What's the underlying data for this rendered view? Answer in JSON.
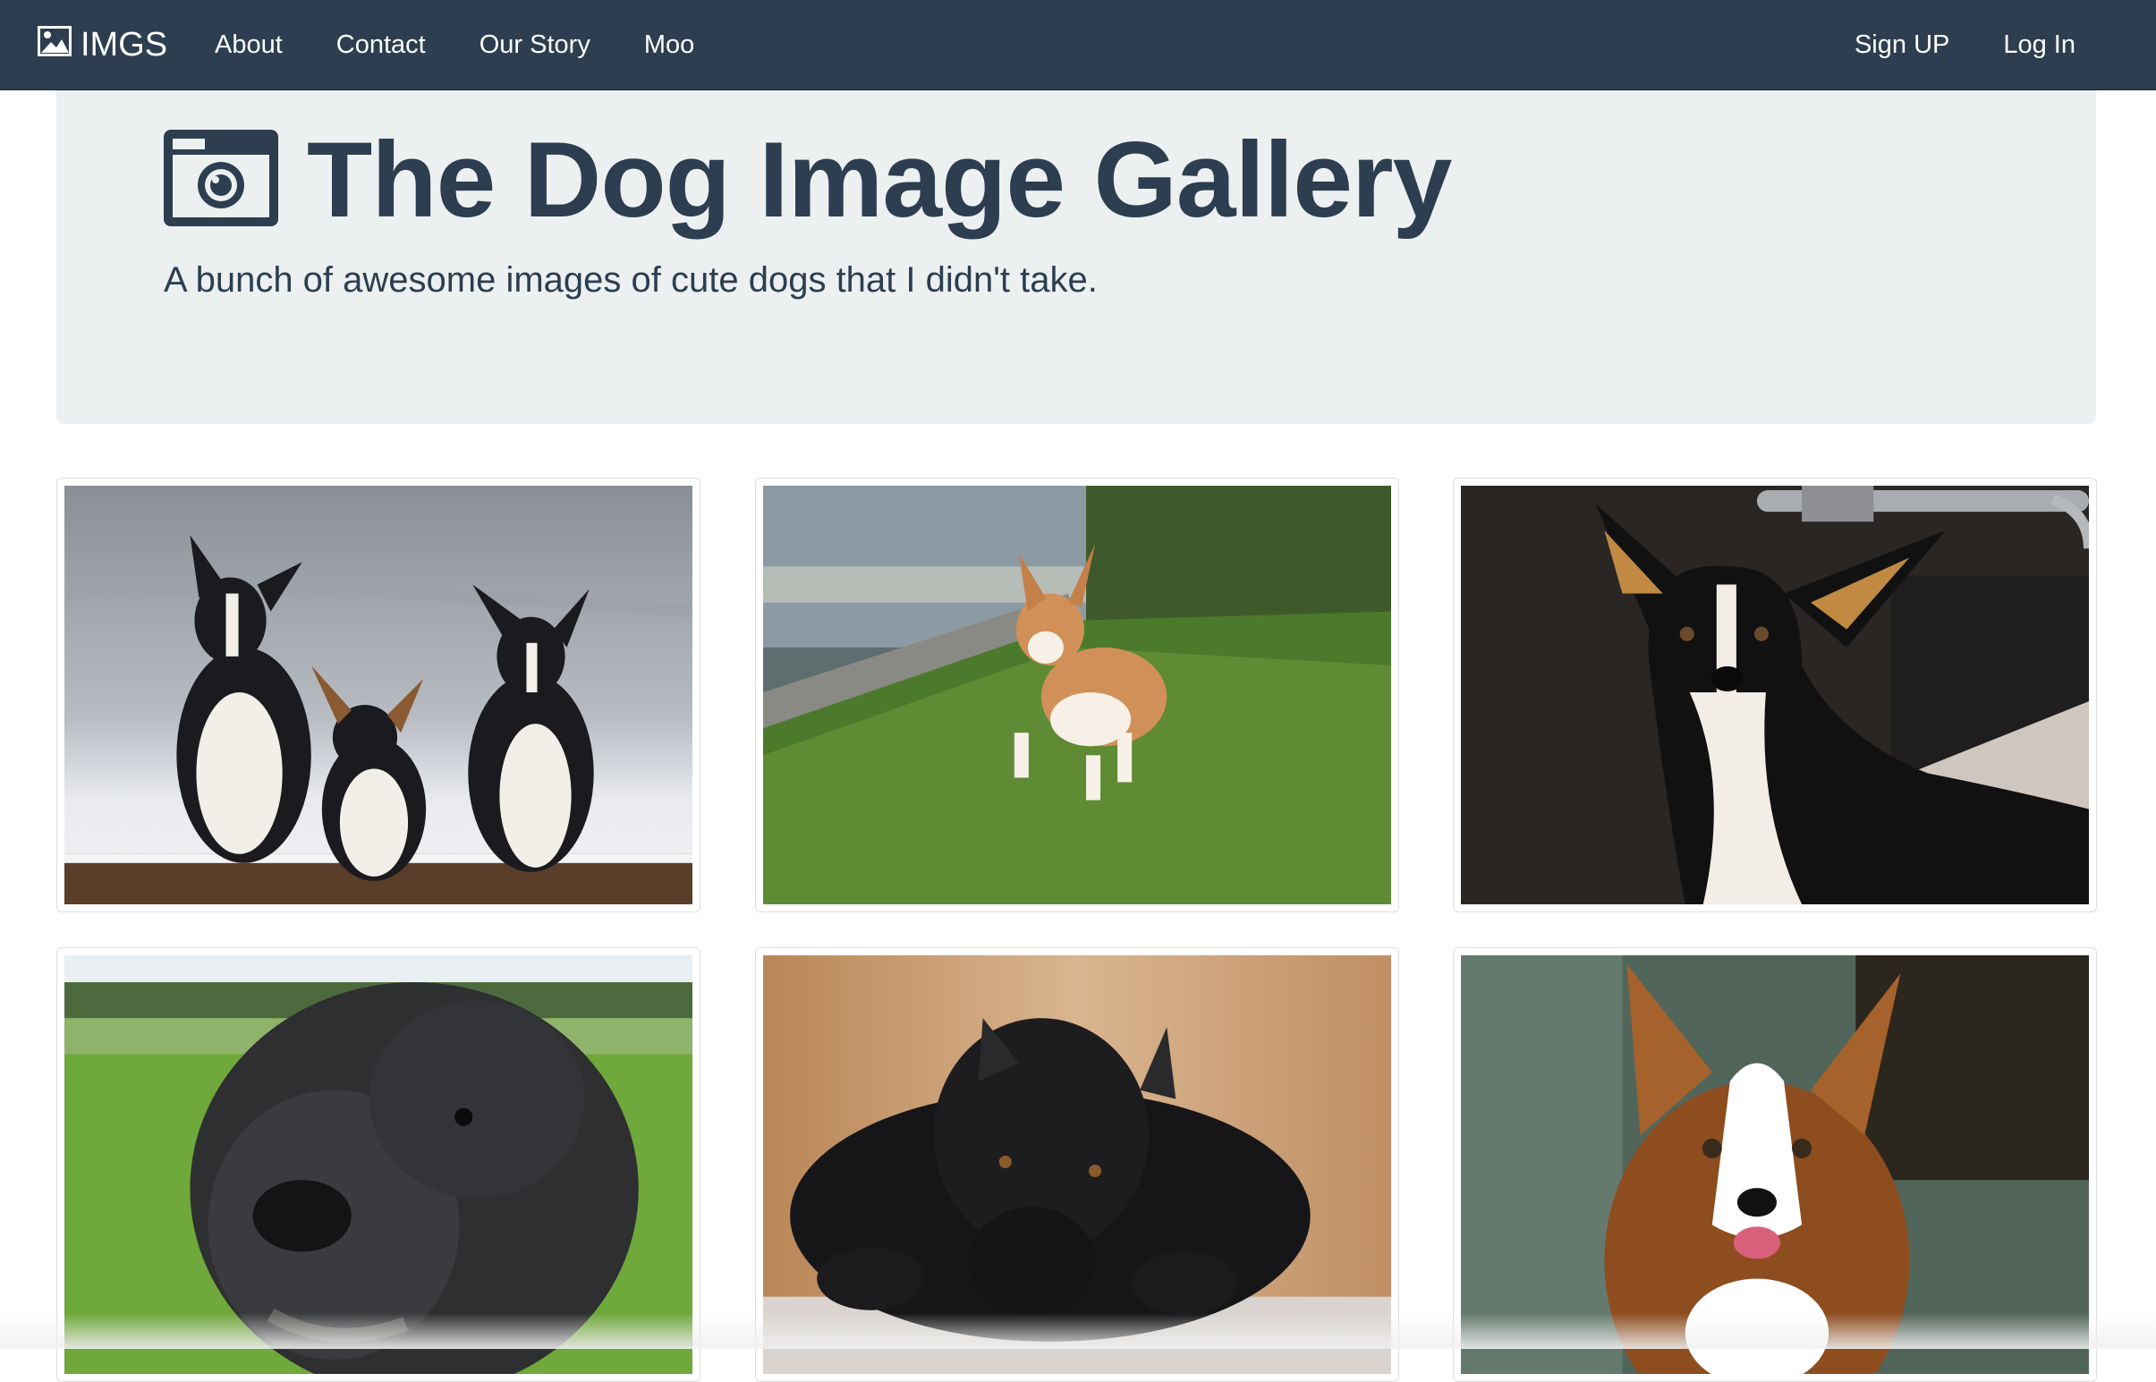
{
  "navbar": {
    "brand": "IMGS",
    "brand_icon": "image-icon",
    "links_left": [
      "About",
      "Contact",
      "Our Story",
      "Moo"
    ],
    "links_right": [
      "Sign UP",
      "Log In"
    ],
    "bg_color": "#2c3e50"
  },
  "jumbotron": {
    "icon": "camera-icon",
    "title": "The Dog Image Gallery",
    "subtitle": "A bunch of awesome images of cute dogs that I didn't take."
  },
  "gallery": {
    "images": [
      {
        "subject": "three corgis on snowy log"
      },
      {
        "subject": "corgi puppy running on grass"
      },
      {
        "subject": "tricolor corgi close-up"
      },
      {
        "subject": "black curly puppy on grass"
      },
      {
        "subject": "black cane corso lying down"
      },
      {
        "subject": "sable corgi in snow"
      }
    ]
  }
}
